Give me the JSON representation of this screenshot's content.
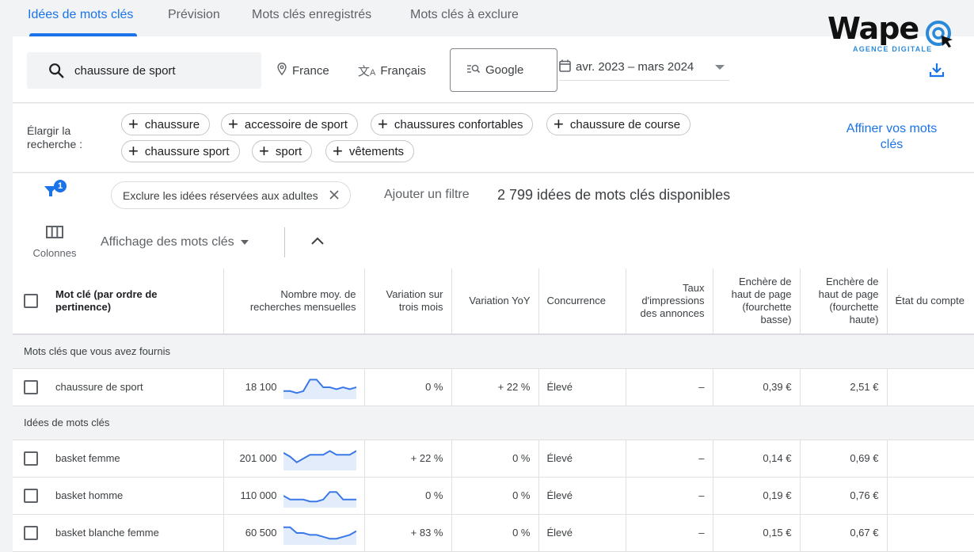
{
  "tabs": [
    {
      "label": "Idées de mots clés",
      "active": true
    },
    {
      "label": "Prévision",
      "active": false
    },
    {
      "label": "Mots clés enregistrés",
      "active": false
    },
    {
      "label": "Mots clés à exclure",
      "active": false
    }
  ],
  "logo": {
    "word": "Wape",
    "subtitle": "AGENCE DIGITALE"
  },
  "search": {
    "query": "chaussure de sport",
    "location": "France",
    "language": "Français",
    "network": "Google",
    "date_range": "avr. 2023 – mars 2024"
  },
  "broaden": {
    "label": "Élargir la recherche :",
    "chips": [
      "chaussure",
      "accessoire de sport",
      "chaussures confortables",
      "chaussure de course",
      "chaussure sport",
      "sport",
      "vêtements"
    ],
    "refine_label": "Affiner vos mots clés"
  },
  "filters": {
    "badge_count": "1",
    "active_filter": "Exclure les idées réservées aux adultes",
    "add_filter": "Ajouter un filtre",
    "available_count": "2 799 idées de mots clés disponibles",
    "columns_label": "Colonnes",
    "view_label": "Affichage des mots clés"
  },
  "table": {
    "headers": [
      "Mot clé (par ordre de pertinence)",
      "Nombre moy. de recherches mensuelles",
      "Variation sur trois mois",
      "Variation YoY",
      "Concurrence",
      "Taux d'impressions des annonces",
      "Enchère de haut de page (fourchette basse)",
      "Enchère de haut de page (fourchette haute)",
      "État du compte"
    ],
    "group_provided": "Mots clés que vous avez fournis",
    "group_ideas": "Idées de mots clés",
    "provided_rows": [
      {
        "keyword": "chaussure de sport",
        "searches": "18 100",
        "trend": [
          3,
          3,
          2,
          3,
          9,
          9,
          5,
          5,
          4,
          5,
          4,
          5
        ],
        "three_month": "0 %",
        "yoy": "+ 22 %",
        "competition": "Élevé",
        "impression_share": "–",
        "bid_low": "0,39 €",
        "bid_high": "2,51 €",
        "account_status": ""
      }
    ],
    "idea_rows": [
      {
        "keyword": "basket femme",
        "searches": "201 000",
        "trend": [
          8,
          6,
          3,
          5,
          7,
          7,
          7,
          9,
          7,
          7,
          7,
          9
        ],
        "three_month": "+ 22 %",
        "yoy": "0 %",
        "competition": "Élevé",
        "impression_share": "–",
        "bid_low": "0,14 €",
        "bid_high": "0,69 €",
        "account_status": ""
      },
      {
        "keyword": "basket homme",
        "searches": "110 000",
        "trend": [
          5,
          3,
          3,
          3,
          2,
          2,
          3,
          7,
          7,
          3,
          3,
          3
        ],
        "three_month": "0 %",
        "yoy": "0 %",
        "competition": "Élevé",
        "impression_share": "–",
        "bid_low": "0,19 €",
        "bid_high": "0,76 €",
        "account_status": ""
      },
      {
        "keyword": "basket blanche femme",
        "searches": "60 500",
        "trend": [
          8,
          8,
          5,
          5,
          4,
          4,
          3,
          2,
          2,
          3,
          4,
          6
        ],
        "three_month": "+ 83 %",
        "yoy": "0 %",
        "competition": "Élevé",
        "impression_share": "–",
        "bid_low": "0,15 €",
        "bid_high": "0,67 €",
        "account_status": ""
      }
    ]
  },
  "colors": {
    "accent": "#1a73e8",
    "spark_line": "#3b78e7",
    "spark_fill": "#e3ecfb"
  }
}
